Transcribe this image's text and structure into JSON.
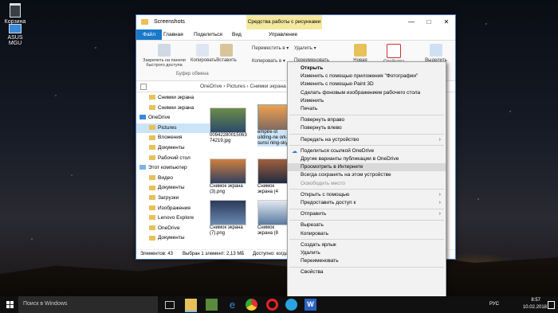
{
  "desktop": {
    "icons": [
      {
        "label": "Корзина"
      },
      {
        "label": "ASUS MGU"
      }
    ]
  },
  "window": {
    "title": "Screenshots",
    "contextual_tab": "Средства работы с рисунками",
    "tabs": [
      "Файл",
      "Главная",
      "Поделиться",
      "Вид",
      "Управление"
    ],
    "ribbon": {
      "pin_label": "Закрепить на панели быстрого доступа",
      "copy_label": "Копировать",
      "paste_label": "Вставить",
      "move_label": "Переместить в ▾",
      "copyto_label": "Копировать в ▾",
      "delete_label": "Удалить ▾",
      "rename_label": "Переименовать",
      "new_label": "Новая",
      "properties_label": "Свойства",
      "select_label": "Выделить",
      "clipboard_group": "Буфер обмена"
    },
    "breadcrumb": [
      "OneDrive",
      "Pictures",
      "Снимки экрана"
    ],
    "nav": {
      "items": [
        {
          "label": "Снимки экрана",
          "type": "folder"
        },
        {
          "label": "Снимки экрана",
          "type": "folder"
        },
        {
          "label": "OneDrive",
          "type": "cloud"
        },
        {
          "label": "Pictures",
          "type": "folder",
          "selected": true
        },
        {
          "label": "Вложения",
          "type": "folder"
        },
        {
          "label": "Документы",
          "type": "folder"
        },
        {
          "label": "Рабочий стол",
          "type": "folder"
        },
        {
          "label": "Этот компьютер",
          "type": "pc"
        },
        {
          "label": "Видео",
          "type": "folder"
        },
        {
          "label": "Документы",
          "type": "folder"
        },
        {
          "label": "Загрузки",
          "type": "folder"
        },
        {
          "label": "Изображения",
          "type": "folder"
        },
        {
          "label": "Lenovo Explore",
          "type": "folder"
        },
        {
          "label": "OneDrive",
          "type": "folder"
        },
        {
          "label": "Документы",
          "type": "folder"
        }
      ]
    },
    "files": [
      {
        "name": "00942280015063 74219.jpg"
      },
      {
        "name": "empire-st uilding-ne ork-sunsi ning-sky"
      },
      {
        "name": "Снимок экрана (3).png"
      },
      {
        "name": "Снимок экрана (4"
      },
      {
        "name": "Снимок экрана (7).png"
      },
      {
        "name": "Снимок экрана (8"
      }
    ],
    "status": {
      "count": "Элементов: 43",
      "selected": "Выбран 1 элемент: 2,13 МБ",
      "available": "Доступно: когда"
    }
  },
  "context_menu": {
    "items": [
      {
        "label": "Открыть",
        "bold": true
      },
      {
        "label": "Изменить с помощью приложения \"Фотографии\""
      },
      {
        "label": "Изменить с помощью Paint 3D"
      },
      {
        "label": "Сделать фоновым изображением рабочего стола"
      },
      {
        "label": "Изменить"
      },
      {
        "label": "Печать"
      },
      {
        "sep": true
      },
      {
        "label": "Повернуть вправо"
      },
      {
        "label": "Повернуть влево"
      },
      {
        "sep": true
      },
      {
        "label": "Передать на устройство",
        "submenu": true
      },
      {
        "sep": true
      },
      {
        "label": "Поделиться ссылкой OneDrive",
        "icon": "cloud"
      },
      {
        "label": "Другие варианты публикации в OneDrive"
      },
      {
        "label": "Просмотреть в Интернете",
        "highlighted": true
      },
      {
        "label": "Всегда сохранять на этом устройстве"
      },
      {
        "label": "Освободить место",
        "disabled": true
      },
      {
        "sep": true
      },
      {
        "label": "Открыть с помощью",
        "submenu": true
      },
      {
        "label": "Предоставить доступ к",
        "submenu": true
      },
      {
        "sep": true
      },
      {
        "label": "Отправить",
        "submenu": true
      },
      {
        "sep": true
      },
      {
        "label": "Вырезать"
      },
      {
        "label": "Копировать"
      },
      {
        "sep": true
      },
      {
        "label": "Создать ярлык"
      },
      {
        "label": "Удалить"
      },
      {
        "label": "Переименовать"
      },
      {
        "sep": true
      },
      {
        "label": "Свойства"
      }
    ]
  },
  "taskbar": {
    "search_placeholder": "Поиск в Windows",
    "lang": "РУС",
    "time": "8:57",
    "date": "10.02.2018",
    "accent": "#0078d7"
  }
}
